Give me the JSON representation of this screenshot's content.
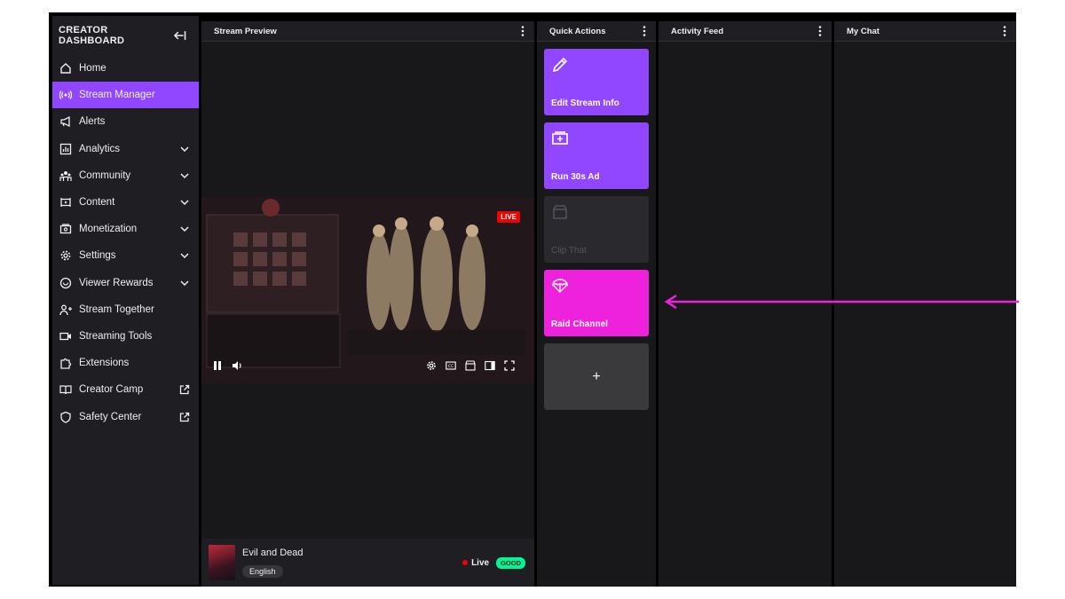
{
  "sidebar": {
    "title": "CREATOR DASHBOARD",
    "items": [
      {
        "label": "Home",
        "icon": "home-icon",
        "expandable": false,
        "external": false
      },
      {
        "label": "Stream Manager",
        "icon": "broadcast-icon",
        "expandable": false,
        "external": false,
        "active": true
      },
      {
        "label": "Alerts",
        "icon": "megaphone-icon",
        "expandable": false,
        "external": false
      },
      {
        "label": "Analytics",
        "icon": "analytics-icon",
        "expandable": true,
        "external": false
      },
      {
        "label": "Community",
        "icon": "community-icon",
        "expandable": true,
        "external": false
      },
      {
        "label": "Content",
        "icon": "content-icon",
        "expandable": true,
        "external": false
      },
      {
        "label": "Monetization",
        "icon": "monetization-icon",
        "expandable": true,
        "external": false
      },
      {
        "label": "Settings",
        "icon": "gear-icon",
        "expandable": true,
        "external": false
      },
      {
        "label": "Viewer Rewards",
        "icon": "rewards-icon",
        "expandable": true,
        "external": false
      },
      {
        "label": "Stream Together",
        "icon": "add-user-icon",
        "expandable": false,
        "external": false
      },
      {
        "label": "Streaming Tools",
        "icon": "camera-icon",
        "expandable": false,
        "external": false
      },
      {
        "label": "Extensions",
        "icon": "puzzle-icon",
        "expandable": false,
        "external": false
      },
      {
        "label": "Creator Camp",
        "icon": "book-icon",
        "expandable": false,
        "external": true
      },
      {
        "label": "Safety Center",
        "icon": "shield-icon",
        "expandable": false,
        "external": true
      }
    ]
  },
  "panels": {
    "preview": "Stream Preview",
    "quick_actions": "Quick Actions",
    "activity": "Activity Feed",
    "chat": "My Chat"
  },
  "video": {
    "live_badge": "LIVE"
  },
  "stream_info": {
    "game": "Evil and Dead",
    "language": "English",
    "status": "Live",
    "health": "GOOD"
  },
  "quick_actions": {
    "edit": "Edit Stream Info",
    "ad": "Run 30s Ad",
    "clip": "Clip That",
    "raid": "Raid Channel",
    "add": "+"
  },
  "colors": {
    "accent_purple": "#9147ff",
    "raid_pink": "#ee22dd",
    "live_red": "#eb0400",
    "good_green": "#00f593"
  }
}
